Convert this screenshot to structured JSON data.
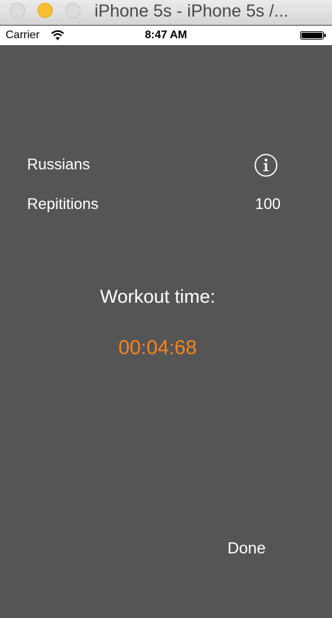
{
  "window": {
    "title": "iPhone 5s - iPhone 5s /..."
  },
  "status_bar": {
    "carrier": "Carrier",
    "time": "8:47 AM",
    "wifi_icon": "wifi-icon",
    "battery_icon": "battery-full-icon"
  },
  "exercise": {
    "name": "Russians",
    "info_icon": "info-icon",
    "reps_label": "Repititions",
    "reps_value": "100"
  },
  "workout": {
    "title": "Workout time:",
    "elapsed": "00:04:68"
  },
  "actions": {
    "done_label": "Done"
  },
  "colors": {
    "background": "#555555",
    "timer": "#f5841f",
    "text": "#ffffff",
    "minimize_button": "#f8bd33"
  }
}
